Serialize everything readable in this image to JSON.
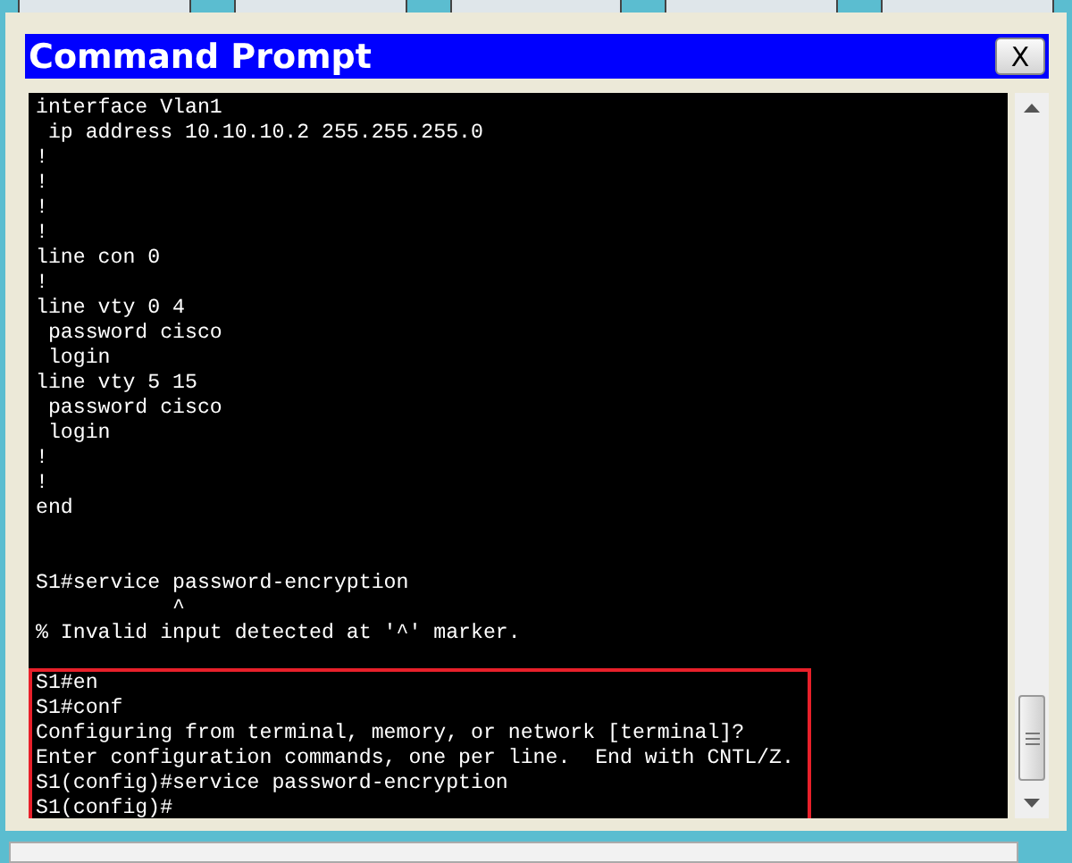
{
  "window": {
    "title": "Command Prompt",
    "close_label": "X"
  },
  "terminal": {
    "blocks": [
      {
        "highlighted": false,
        "lines": [
          "interface Vlan1",
          " ip address 10.10.10.2 255.255.255.0",
          "!",
          "!",
          "!",
          "!",
          "line con 0",
          "!",
          "line vty 0 4",
          " password cisco",
          " login",
          "line vty 5 15",
          " password cisco",
          " login",
          "!",
          "!",
          "end"
        ]
      },
      {
        "highlighted": false,
        "lines": [
          "S1#service password-encryption",
          "           ^",
          "% Invalid input detected at '^' marker."
        ]
      },
      {
        "highlighted": true,
        "lines": [
          "S1#en",
          "S1#conf",
          "Configuring from terminal, memory, or network [terminal]?",
          "Enter configuration commands, one per line.  End with CNTL/Z.",
          "S1(config)#service password-encryption",
          "S1(config)#"
        ]
      }
    ]
  }
}
